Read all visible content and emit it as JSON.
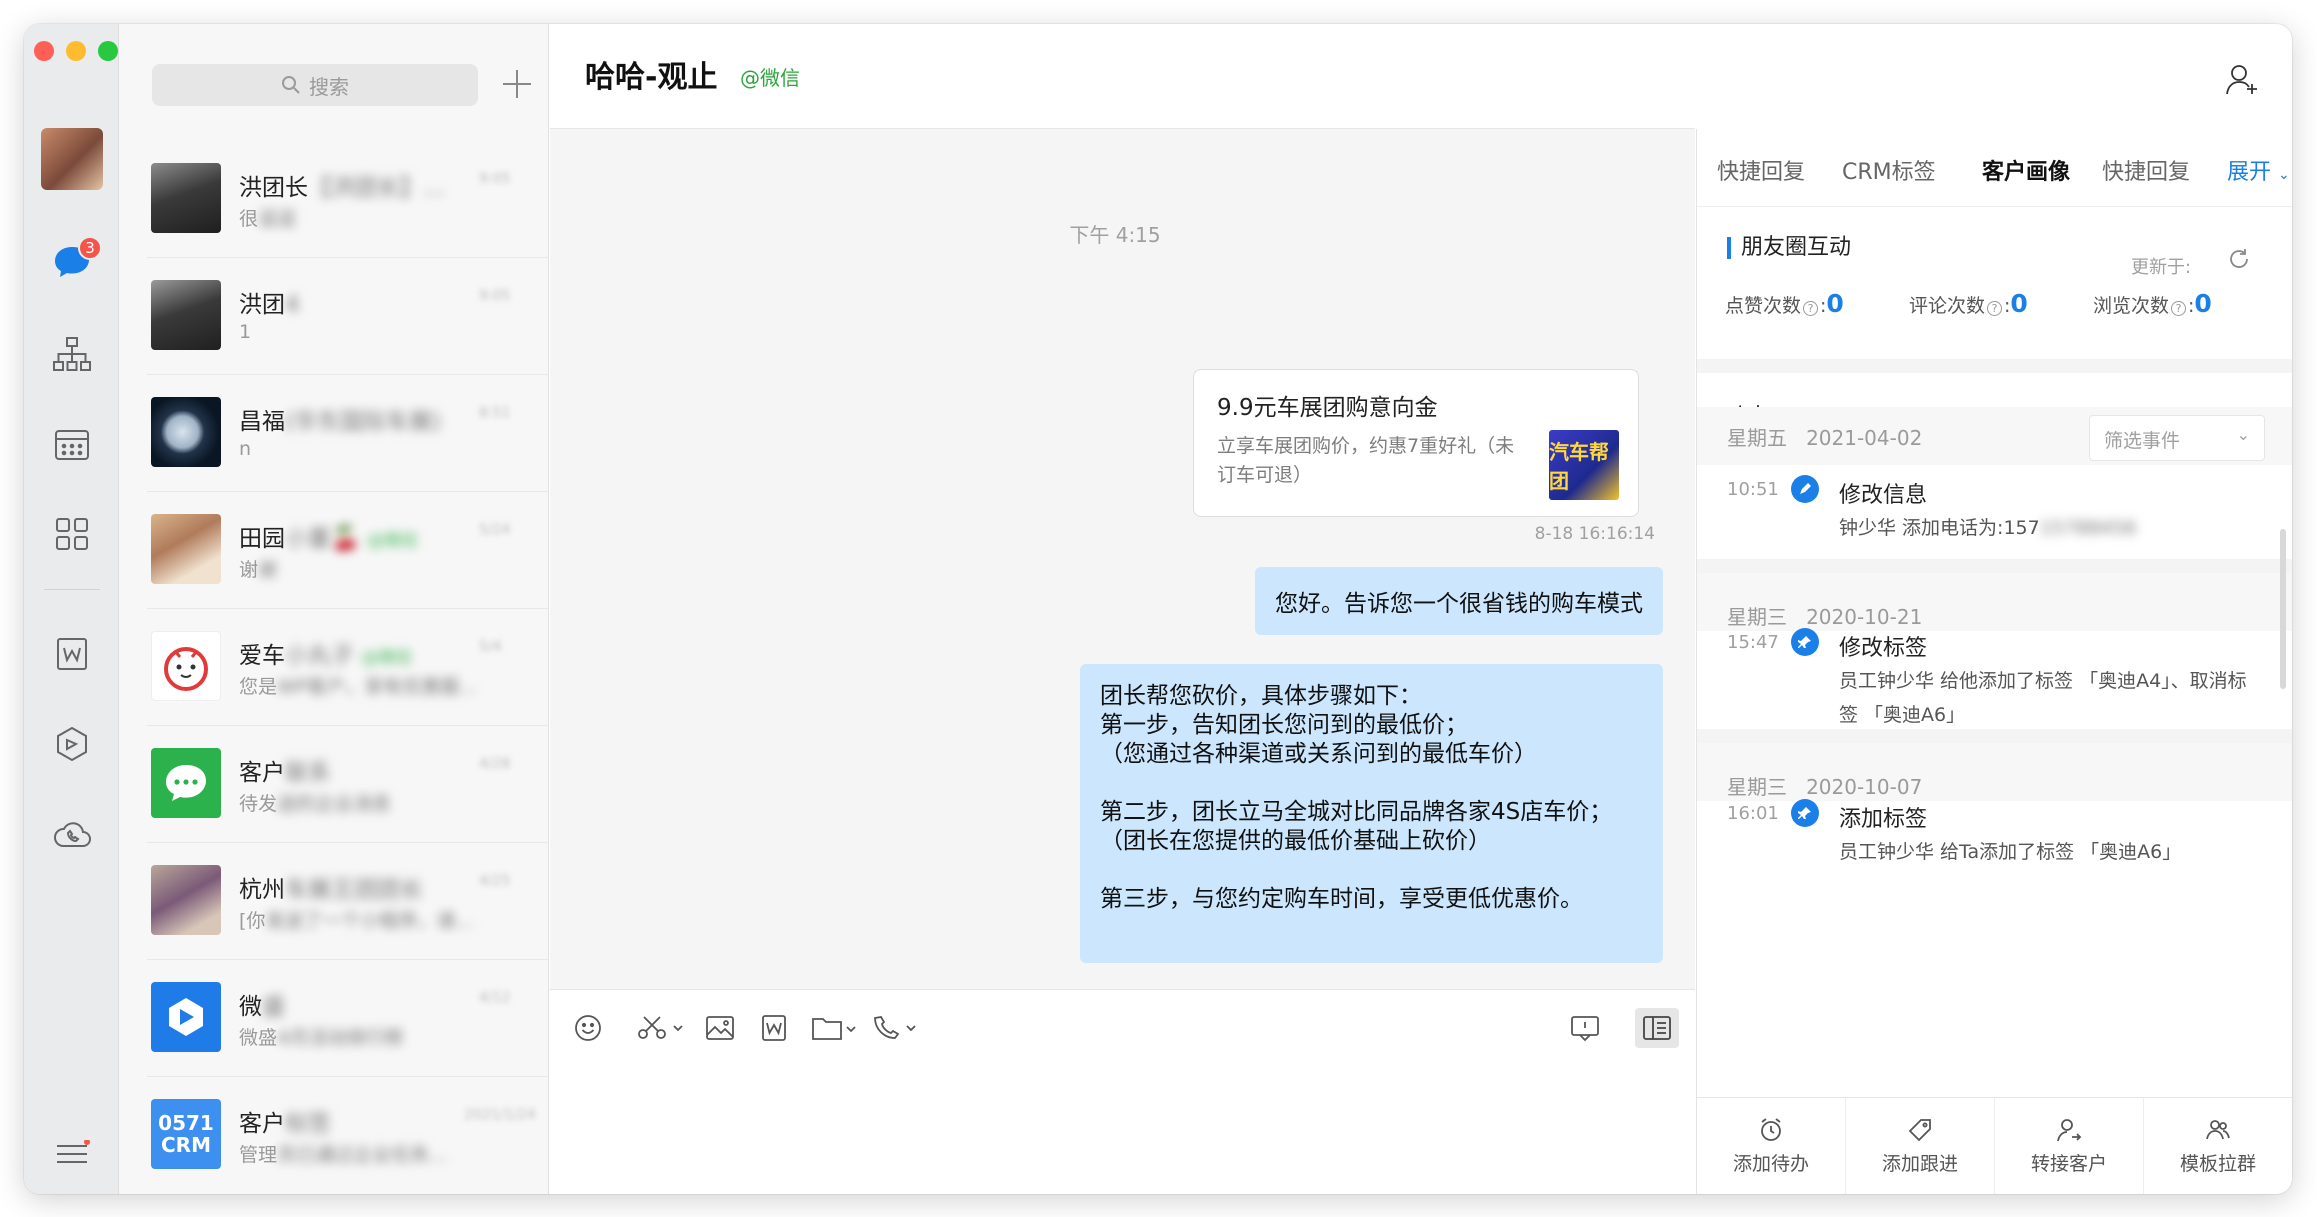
{
  "rail": {
    "unread_badge": "3",
    "colors": {
      "close": "#fe5f57",
      "minimize": "#febc2e",
      "zoom": "#28c840"
    }
  },
  "search": {
    "placeholder": "搜索"
  },
  "chats": [
    {
      "name": "洪团长",
      "name_blur": "【洪团长】...",
      "msg": "很",
      "msg_blur": "逗逗",
      "time": "9:05"
    },
    {
      "name": "洪团",
      "name_blur": "4",
      "msg": "1",
      "msg_blur": "",
      "time": "9:05"
    },
    {
      "name": "昌福",
      "name_blur": "(华东国际车展)",
      "msg": "n",
      "msg_blur": "",
      "time": "8:51"
    },
    {
      "name": "田园",
      "name_blur": "小董🍒",
      "name_tag": "@微信",
      "msg": "谢",
      "msg_blur": "谢",
      "time": "5/24"
    },
    {
      "name": "爱车",
      "name_blur": "小丸子",
      "name_tag": "@微信",
      "msg": "您是",
      "msg_blur": "WP客户，享有优惠服...",
      "time": "5/4"
    },
    {
      "name": "客户",
      "name_blur": "联系",
      "msg": "待发",
      "msg_blur": "送的企业消息",
      "time": "4/28"
    },
    {
      "name": "杭州",
      "name_blur": "车展王团团长",
      "msg": "[你",
      "msg_blur": "发送了一个小程序，请...",
      "time": "4/25"
    },
    {
      "name": "微",
      "name_blur": "盛",
      "msg": "微盛",
      "msg_blur": "4月活动排行榜",
      "time": "4/12"
    },
    {
      "name": "客户",
      "name_blur": "标签",
      "msg": "管理",
      "msg_blur": "员已通过企业任务...",
      "time": "2021/1/24"
    }
  ],
  "chat": {
    "title": "哈哈-观止",
    "source_tag": "@微信",
    "time_divider": "下午 4:15",
    "card": {
      "title": "9.9元车展团购意向金",
      "desc": "立享车展团购价，约惠7重好礼（未订车可退）",
      "thumb_text": "汽车帮团"
    },
    "card_timestamp": "8-18 16:16:14",
    "msg1": "您好。告诉您一个很省钱的购车模式",
    "msg2": "团长帮您砍价，具体步骤如下：\n第一步，告知团长您问到的最低价；\n（您通过各种渠道或关系问到的最低车价）\n\n第二步，团长立马全城对比同品牌各家4S店车价；\n（团长在您提供的最低价基础上砍价）\n\n第三步，与您约定购车时间，享受更低优惠价。"
  },
  "side": {
    "tabs": [
      "快捷回复",
      "CRM标签",
      "客户画像",
      "快捷回复"
    ],
    "expand_label": "展开",
    "section_title": "朋友圈互动",
    "updated_label": "更新于:",
    "stats": [
      {
        "label": "点赞次数",
        "value": "0"
      },
      {
        "label": "评论次数",
        "value": "0"
      },
      {
        "label": "浏览次数",
        "value": "0"
      }
    ],
    "dynamic_tab": "动态",
    "filter_placeholder": "筛选事件",
    "groups": [
      {
        "date": "星期五   2021-04-02",
        "time": "10:51",
        "title": "修改信息",
        "desc": "钟少华 添加电话为:157",
        "desc_blur": "15788456"
      },
      {
        "date": "星期三   2020-10-21",
        "time": "15:47",
        "title": "修改标签",
        "desc": "员工钟少华 给他添加了标签 「奥迪A4」、取消标签 「奥迪A6」",
        "desc_blur": ""
      },
      {
        "date": "星期三   2020-10-07",
        "time": "16:01",
        "title": "添加标签",
        "desc": "员工钟少华 给Ta添加了标签 「奥迪A6」",
        "desc_blur": ""
      }
    ],
    "actions": [
      "添加待办",
      "添加跟进",
      "转接客户",
      "模板拉群"
    ]
  }
}
